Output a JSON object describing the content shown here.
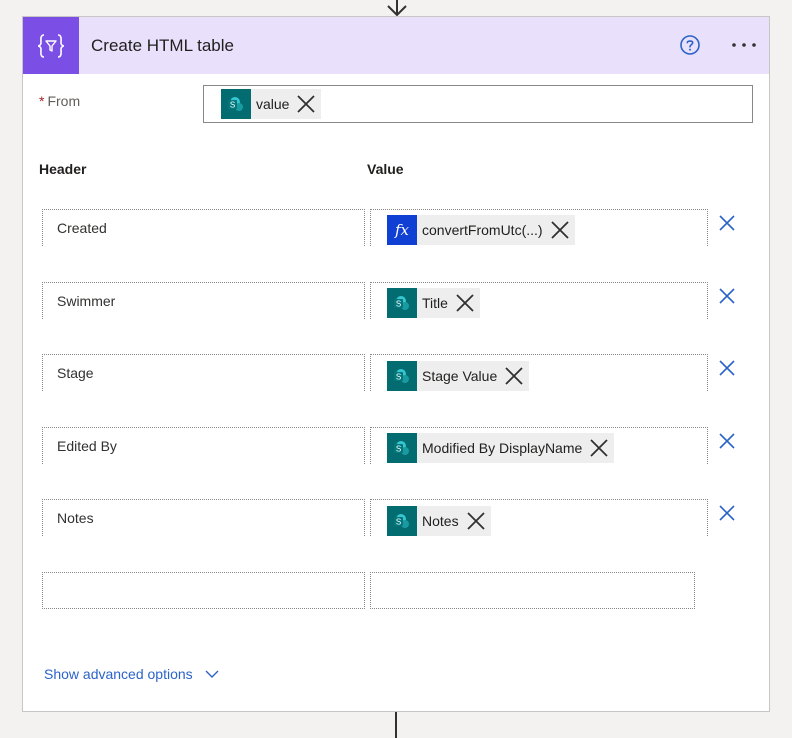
{
  "action": {
    "title": "Create HTML table",
    "icon": "filter-braces-icon",
    "header_color": "#e9e1fc",
    "icon_color": "#7b4fe6"
  },
  "from": {
    "label": "From",
    "required_marker": "*",
    "token": {
      "label": "value",
      "icon": "sharepoint-icon"
    }
  },
  "columns": {
    "header": "Header",
    "value": "Value"
  },
  "rows": [
    {
      "header": "Created",
      "value_token": "convertFromUtc(...)",
      "value_icon": "fx-icon"
    },
    {
      "header": "Swimmer",
      "value_token": "Title",
      "value_icon": "sharepoint-icon"
    },
    {
      "header": "Stage",
      "value_token": "Stage Value",
      "value_icon": "sharepoint-icon"
    },
    {
      "header": "Edited By",
      "value_token": "Modified By DisplayName",
      "value_icon": "sharepoint-icon"
    },
    {
      "header": "Notes",
      "value_token": "Notes",
      "value_icon": "sharepoint-icon"
    }
  ],
  "empty_row": {
    "header": "",
    "value": ""
  },
  "advanced": {
    "label": "Show advanced options"
  },
  "colors": {
    "link": "#2b63c9",
    "sharepoint": "#036c70",
    "fx": "#0f3fd3"
  }
}
